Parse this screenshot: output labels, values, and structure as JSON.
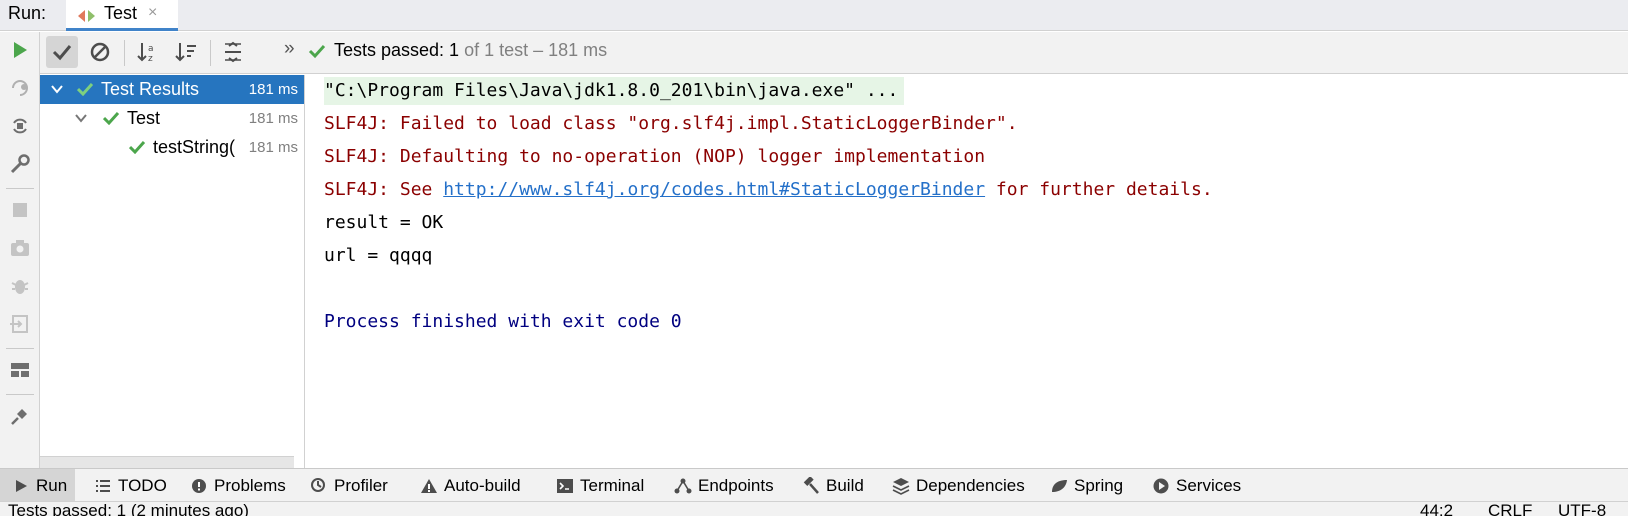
{
  "run_bar": {
    "label": "Run:",
    "tab_label": "Test",
    "close_glyph": "×"
  },
  "toolbar": {
    "expand_glyph": "»",
    "status_passed": "Tests passed: 1",
    "status_rest": "of 1 test – 181 ms"
  },
  "tree": {
    "items": [
      {
        "name": "Test Results",
        "time": "181 ms"
      },
      {
        "name": "Test",
        "time": "181 ms"
      },
      {
        "name": "testString(",
        "time": "181 ms"
      }
    ]
  },
  "console": {
    "cmd": "\"C:\\Program Files\\Java\\jdk1.8.0_201\\bin\\java.exe\" ...",
    "err1": "SLF4J: Failed to load class \"org.slf4j.impl.StaticLoggerBinder\".",
    "err2": "SLF4J: Defaulting to no-operation (NOP) logger implementation",
    "err3_prefix": "SLF4J: See ",
    "err3_link": "http://www.slf4j.org/codes.html#StaticLoggerBinder",
    "err3_suffix": " for further details.",
    "out1": "result = OK",
    "out2": "url = qqqq",
    "finish": "Process finished with exit code 0"
  },
  "bottom_bar": {
    "items": [
      "Run",
      "TODO",
      "Problems",
      "Profiler",
      "Auto-build",
      "Terminal",
      "Endpoints",
      "Build",
      "Dependencies",
      "Spring",
      "Services"
    ]
  },
  "status_bar": {
    "text": "Tests passed: 1 (2 minutes ago)",
    "position": "44:2",
    "line_sep": "CRLF",
    "encoding": "UTF-8"
  },
  "colors": {
    "accent": "#2675bf",
    "pass_green": "#4ca64c",
    "error_red": "#8b0000",
    "link_blue": "#2470c9",
    "finish_navy": "#000080"
  }
}
